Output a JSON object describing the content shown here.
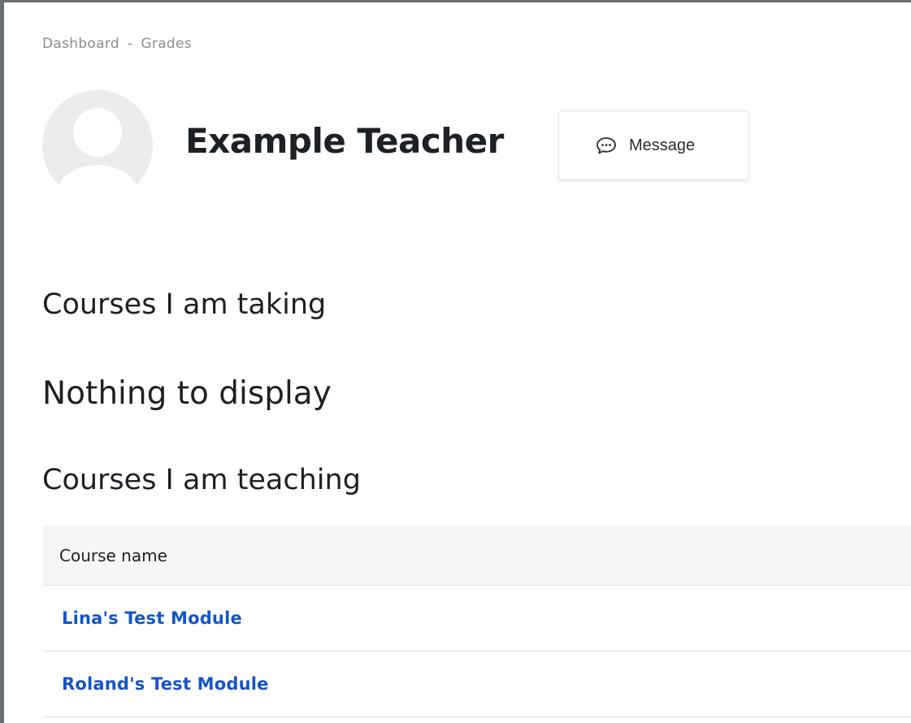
{
  "breadcrumb": {
    "items": [
      "Dashboard",
      "Grades"
    ],
    "separator": "-"
  },
  "profile": {
    "name": "Example Teacher",
    "message_label": "Message"
  },
  "sections": {
    "taking_heading": "Courses I am taking",
    "taking_empty": "Nothing to display",
    "teaching_heading": "Courses I am teaching"
  },
  "table": {
    "column_header": "Course name",
    "rows": [
      {
        "course": "Lina's Test Module"
      },
      {
        "course": "Roland's Test Module"
      }
    ]
  },
  "icons": {
    "message": "chat-bubble-icon",
    "avatar": "user-avatar-icon"
  },
  "colors": {
    "link": "#1555c8",
    "text": "#1d2125",
    "muted": "#8a8d91",
    "frame": "#6b6e72"
  }
}
